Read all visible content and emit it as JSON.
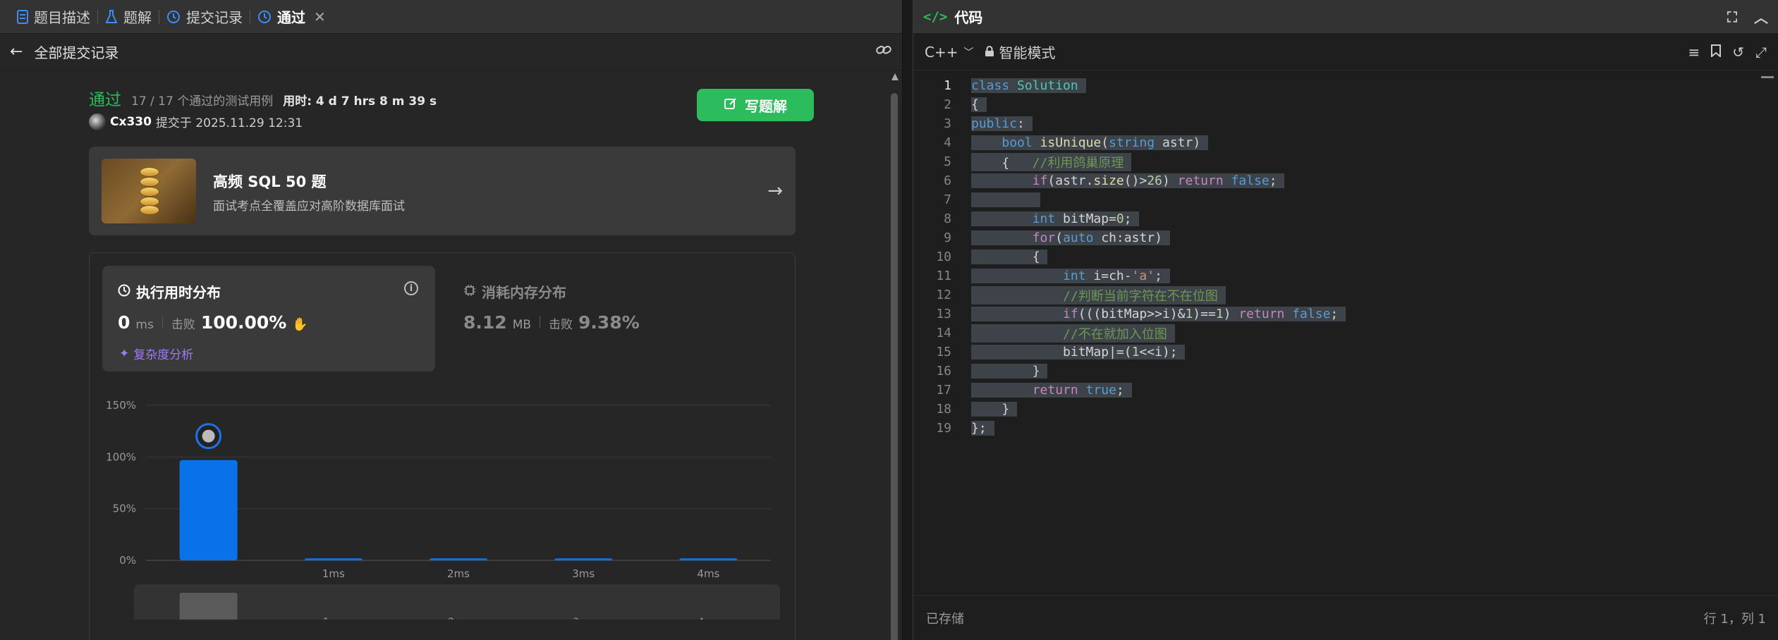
{
  "left_tabs": [
    {
      "label": "题目描述",
      "icon": "document-icon"
    },
    {
      "label": "题解",
      "icon": "flask-icon"
    },
    {
      "label": "提交记录",
      "icon": "history-icon"
    },
    {
      "label": "通过",
      "icon": "history-icon"
    }
  ],
  "back": {
    "label": "全部提交记录"
  },
  "submission": {
    "status": "通过",
    "testcases": "17 / 17 个通过的测试用例",
    "runtime_prefix": "用时: 4 d 7 hrs 8 m 39 s",
    "author": "Cx330",
    "submitted": "提交于 2025.11.29 12:31"
  },
  "write_button": {
    "label": "写题解"
  },
  "promo": {
    "title": "高频 SQL 50 题",
    "subtitle": "面试考点全覆盖应对高阶数据库面试"
  },
  "runtime_card": {
    "title": "执行用时分布",
    "value": "0",
    "unit": "ms",
    "beats_label": "击败",
    "beats": "100.00%",
    "complexity": "复杂度分析"
  },
  "memory_card": {
    "title": "消耗内存分布",
    "value": "8.12",
    "unit": "MB",
    "beats_label": "击败",
    "beats": "9.38%"
  },
  "chart_data": {
    "type": "bar",
    "categories": [
      "0ms",
      "1ms",
      "2ms",
      "3ms",
      "4ms"
    ],
    "tick_labels": [
      "",
      "1ms",
      "2ms",
      "3ms",
      "4ms"
    ],
    "values": [
      97,
      2,
      2,
      2,
      2
    ],
    "y_ticks": [
      "0%",
      "50%",
      "100%",
      "150%"
    ],
    "ylim": [
      0,
      150
    ],
    "bar_color": "#0a72e8",
    "highlight_index": 0
  },
  "editor": {
    "title": "代码",
    "language": "C++",
    "mode": "智能模式",
    "status": "已存储",
    "cursor": "行 1，列 1"
  },
  "code_lines": [
    "class Solution",
    "{",
    "public:",
    "    bool isUnique(string astr)",
    "    {   //利用鸽巢原理",
    "        if(astr.size()>26) return false;",
    "        ",
    "        int bitMap=0;",
    "        for(auto ch:astr)",
    "        {",
    "            int i=ch-'a';",
    "            //判断当前字符在不在位图",
    "            if(((bitMap>>i)&1)==1) return false;",
    "            //不在就加入位图",
    "            bitMap|=(1<<i);",
    "        }",
    "        return true;",
    "    }",
    "};"
  ],
  "colors": {
    "accent_green": "#2cbb5d",
    "bar_blue": "#0a72e8",
    "purple": "#9d7bff"
  }
}
